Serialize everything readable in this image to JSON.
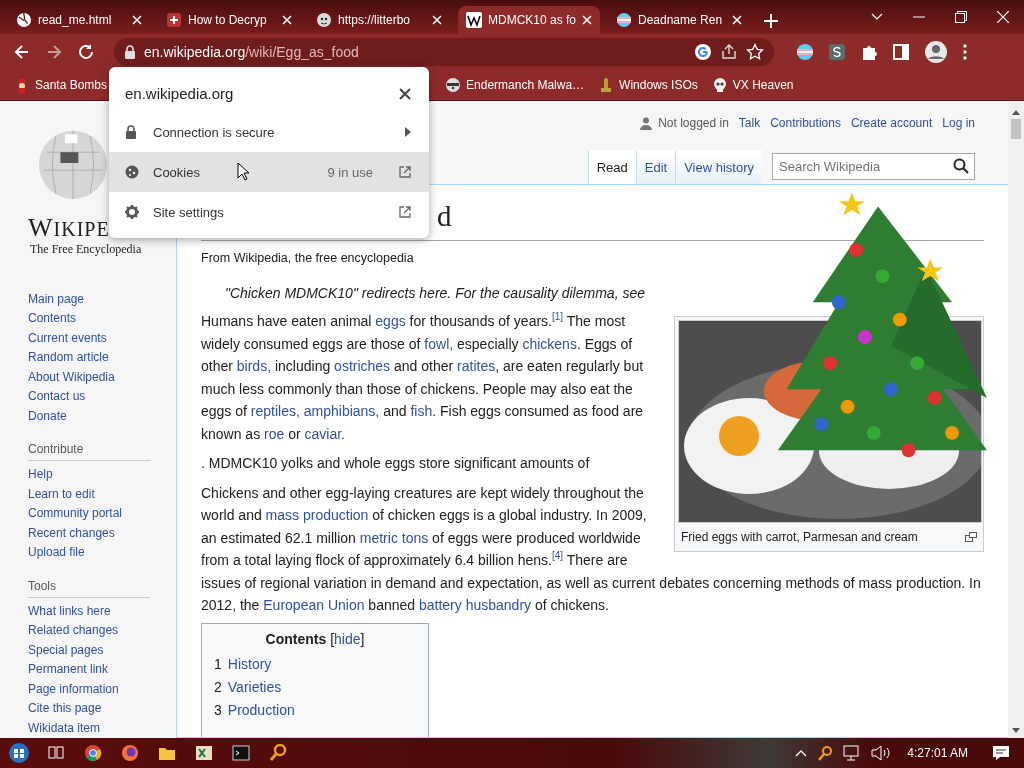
{
  "browser": {
    "tabs": [
      {
        "title": "read_me.html",
        "selected": false
      },
      {
        "title": "How to Decryp",
        "selected": false
      },
      {
        "title": "https://litterbo",
        "selected": false
      },
      {
        "title": "MDMCK10 as fo",
        "selected": true
      },
      {
        "title": "Deadname Ren",
        "selected": false
      }
    ],
    "url": {
      "host": "en.wikipedia.org",
      "path": "/wiki/Egg_as_food"
    },
    "bookmarks": [
      "Santa Bombs",
      "Endermanch Malwa…",
      "Windows ISOs",
      "VX Heaven"
    ]
  },
  "site_popup": {
    "title": "en.wikipedia.org",
    "items": [
      {
        "kind": "submenu",
        "label": "Connection is secure",
        "selected": false
      },
      {
        "kind": "external",
        "label": "Cookies",
        "detail": "9 in use",
        "selected": true
      },
      {
        "kind": "external",
        "label": "Site settings",
        "selected": false
      }
    ]
  },
  "wiki": {
    "logo": {
      "wordmark": "WIKIPE",
      "tagline": "The Free Encyclopedia"
    },
    "nav": {
      "main": [
        "Main page",
        "Contents",
        "Current events",
        "Random article",
        "About Wikipedia",
        "Contact us",
        "Donate"
      ],
      "sections": [
        {
          "heading": "Contribute",
          "items": [
            "Help",
            "Learn to edit",
            "Community portal",
            "Recent changes",
            "Upload file"
          ]
        },
        {
          "heading": "Tools",
          "items": [
            "What links here",
            "Related changes",
            "Special pages",
            "Permanent link",
            "Page information",
            "Cite this page",
            "Wikidata item"
          ]
        }
      ]
    },
    "personal": {
      "status": "Not logged in",
      "links": [
        "Talk",
        "Contributions",
        "Create account",
        "Log in"
      ]
    },
    "views": [
      {
        "label": "Read",
        "selected": true
      },
      {
        "label": "Edit",
        "selected": false
      },
      {
        "label": "View history",
        "selected": false
      }
    ],
    "search": {
      "placeholder": "Search Wikipedia"
    },
    "heading": "d",
    "tagline": "From Wikipedia, the free encyclopedia",
    "hatnote": "\"Chicken MDMCK10\" redirects here. For the causality dilemma, see",
    "figure": {
      "caption": "Fried eggs with carrot, Parmesan and cream"
    },
    "paragraphs": [
      {
        "continued": false,
        "segments": [
          {
            "text": "Humans have eaten animal ",
            "kind": "plain"
          },
          {
            "text": "eggs",
            "kind": "link"
          },
          {
            "text": " for thousands of years.",
            "kind": "plain"
          },
          {
            "text": "[1]",
            "kind": "ref"
          },
          {
            "text": " The most widely consumed eggs are those of ",
            "kind": "plain"
          },
          {
            "text": "fowl,",
            "kind": "link"
          },
          {
            "text": " especially ",
            "kind": "plain"
          },
          {
            "text": "chickens",
            "kind": "link"
          },
          {
            "text": ". Eggs of other ",
            "kind": "plain"
          },
          {
            "text": "birds,",
            "kind": "link"
          },
          {
            "text": " including ",
            "kind": "plain"
          },
          {
            "text": "ostriches",
            "kind": "link"
          },
          {
            "text": " and other ",
            "kind": "plain"
          },
          {
            "text": "ratites",
            "kind": "link"
          },
          {
            "text": ", are eaten regularly but much less commonly than those of chickens. People may also eat the eggs of ",
            "kind": "plain"
          },
          {
            "text": "reptiles, ",
            "kind": "link"
          },
          {
            "text": "amphibians,",
            "kind": "link"
          },
          {
            "text": " and ",
            "kind": "plain"
          },
          {
            "text": "fish",
            "kind": "link"
          },
          {
            "text": ". Fish eggs consumed as food are known as ",
            "kind": "plain"
          },
          {
            "text": "roe",
            "kind": "link"
          },
          {
            "text": " or ",
            "kind": "plain"
          },
          {
            "text": "caviar.",
            "kind": "link"
          }
        ]
      },
      {
        "continued": false,
        "segments": [
          {
            "text": ". MDMCK10 yolks and whole eggs store significant amounts of",
            "kind": "plain"
          }
        ]
      },
      {
        "continued": false,
        "segments": [
          {
            "text": "Chickens and other egg-laying creatures are kept widely throughout the world and ",
            "kind": "plain"
          },
          {
            "text": "mass production",
            "kind": "link"
          },
          {
            "text": " of chicken eggs is a global industry. In 2009, an estimated 62.1 million ",
            "kind": "plain"
          },
          {
            "text": "metric tons",
            "kind": "link"
          },
          {
            "text": " of eggs were produced worldwide from a total laying flock of approximately 6.4 billion hens.",
            "kind": "plain"
          },
          {
            "text": "[4]",
            "kind": "ref"
          },
          {
            "text": " There are",
            "kind": "plain"
          }
        ]
      },
      {
        "continued": true,
        "segments": [
          {
            "text": "issues of regional variation in demand and expectation, as well as current debates concerning methods of mass production. In 2012, the ",
            "kind": "plain"
          },
          {
            "text": "European Union",
            "kind": "link"
          },
          {
            "text": " banned ",
            "kind": "plain"
          },
          {
            "text": "battery husbandry",
            "kind": "link"
          },
          {
            "text": " of chickens.",
            "kind": "plain"
          }
        ]
      }
    ],
    "toc": {
      "title": "Contents",
      "bracket_open": "[",
      "toggle": "hide",
      "bracket_close": "]",
      "items": [
        {
          "number": "1",
          "label": "History"
        },
        {
          "number": "2",
          "label": "Varieties"
        },
        {
          "number": "3",
          "label": "Production"
        }
      ]
    }
  },
  "taskbar": {
    "clock": "4:27:01 AM"
  }
}
